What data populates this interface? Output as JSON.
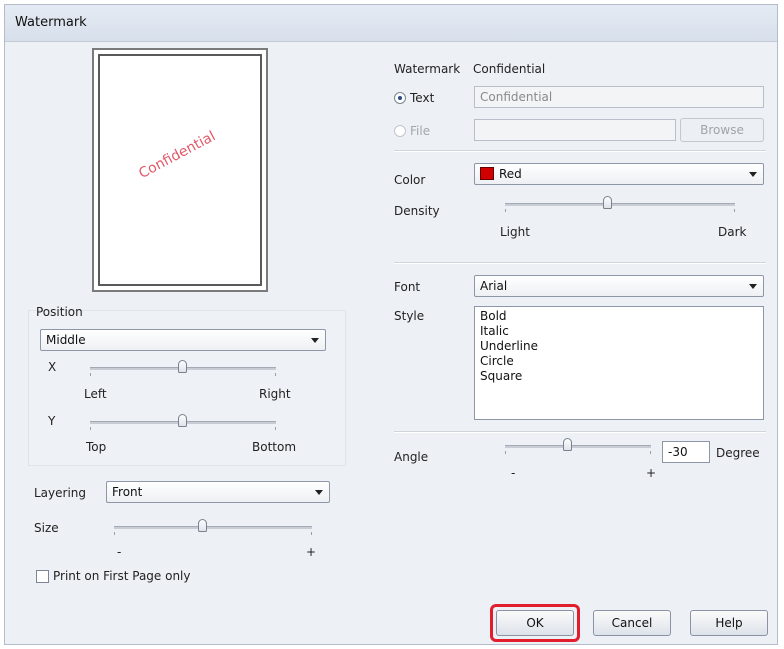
{
  "window": {
    "title": "Watermark"
  },
  "preview": {
    "watermark_text": "Confidential"
  },
  "position": {
    "group_label": "Position",
    "selected": "Middle",
    "x_label": "X",
    "x_min_label": "Left",
    "x_max_label": "Right",
    "y_label": "Y",
    "y_min_label": "Top",
    "y_max_label": "Bottom"
  },
  "layering": {
    "label": "Layering",
    "selected": "Front"
  },
  "size": {
    "label": "Size",
    "min_label": "-",
    "max_label": "+"
  },
  "print_first_page": {
    "label": "Print on First Page only",
    "checked": false
  },
  "watermark": {
    "label": "Watermark",
    "selected_name": "Confidential",
    "text_radio_label": "Text",
    "text_value": "Confidential",
    "file_radio_label": "File",
    "file_value": "",
    "browse_label": "Browse"
  },
  "color": {
    "label": "Color",
    "selected": "Red",
    "swatch": "#d00000"
  },
  "density": {
    "label": "Density",
    "min_label": "Light",
    "max_label": "Dark"
  },
  "font": {
    "label": "Font",
    "selected": "Arial"
  },
  "style": {
    "label": "Style",
    "options": [
      "Bold",
      "Italic",
      "Underline",
      "Circle",
      "Square"
    ]
  },
  "angle": {
    "label": "Angle",
    "value": "-30",
    "unit": "Degree",
    "min_label": "-",
    "max_label": "+"
  },
  "buttons": {
    "ok": "OK",
    "cancel": "Cancel",
    "help": "Help"
  },
  "colors": {
    "ok_highlight": "#e01e2c",
    "watermark_preview": "#e05a6a"
  }
}
